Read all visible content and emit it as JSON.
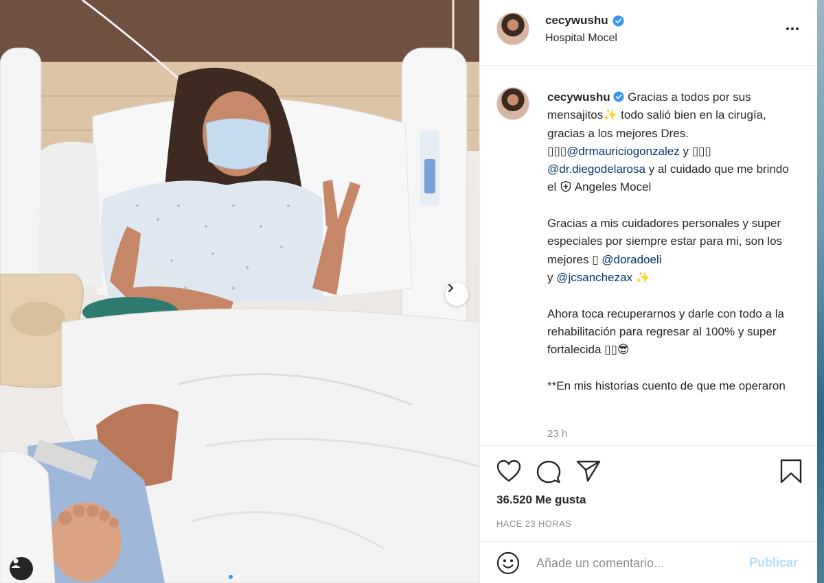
{
  "post": {
    "username": "cecywushu",
    "location": "Hospital Mocel",
    "verified_icon": "verified-badge-icon",
    "caption_parts": {
      "p1": " Gracias a todos por sus mensajitos",
      "p2": " todo salió bien en la cirugía, gracias a los mejores Dres. ",
      "glyphs_a": "▯▯▯",
      "mention1": "@drmauriciogonzalez",
      "p3": " y ",
      "glyphs_b": "▯▯▯",
      "p3b": " ",
      "mention2": "@dr.diegodelarosa",
      "p4": " y al cuidado que me brindo el ",
      "p5": " Angeles Mocel\n\nGracias a mis cuidadores personales y super especiales por siempre estar para mi, son los mejores ",
      "glyph_c": "▯",
      "p5b": " ",
      "mention3": "@doradoeli",
      "p6": "\ny ",
      "mention4": "@jcsanchezax",
      "p7": "\n\nAhora toca recuperarnos y darle con todo a la rehabilitación para regresar al 100% y super fortalecida ",
      "glyphs_d": "▯▯",
      "p8": "\n\n**En mis historias cuento de que me operaron"
    },
    "time_ago": "23 h",
    "likes": "36.520 Me gusta",
    "date": "HACE 23 HORAS",
    "comment_placeholder": "Añade un comentario...",
    "publish_label": "Publicar",
    "carousel": {
      "count": 2,
      "active": 0
    }
  },
  "colors": {
    "accent": "#3897f0",
    "mention": "#00376b",
    "publish_disabled": "#b2dffc",
    "muted": "#8e8e8e"
  }
}
